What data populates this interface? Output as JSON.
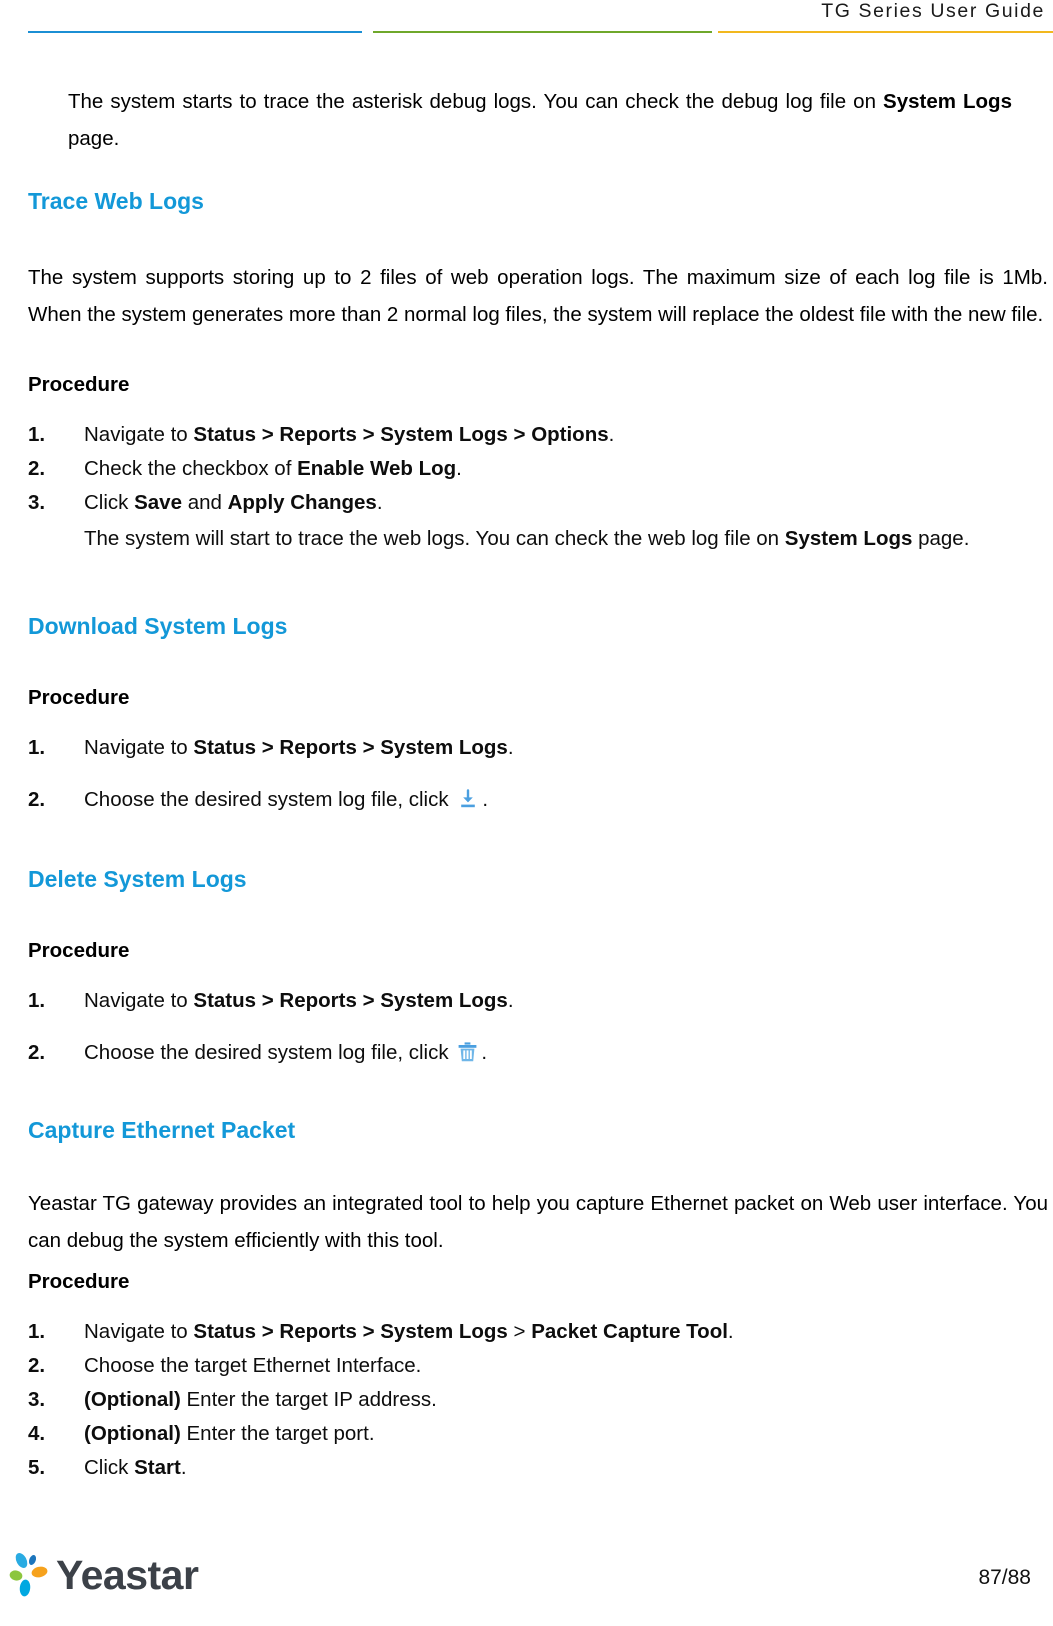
{
  "header": {
    "title": "TG Series User Guide",
    "rule_colors": {
      "blue": "#1B8FD4",
      "green": "#6FA82B",
      "yellow": "#F2B81E"
    }
  },
  "theme": {
    "heading_color": "#1398D8",
    "icon_color": "#4A9FE0",
    "body_color": "#0d0d0d"
  },
  "intro": {
    "text_before": "The system starts to trace the asterisk debug logs. You can check the debug log file on ",
    "bold": "System Logs",
    "text_after": " page."
  },
  "sections": [
    {
      "heading": "Trace Web Logs",
      "intro": "The system supports storing up to 2 files of web operation logs. The maximum size of each log file is 1Mb. When the system generates more than 2 normal log files, the system will replace the oldest file with the new file.",
      "procedure_label": "Procedure",
      "steps": [
        {
          "num": "1.",
          "parts": [
            {
              "text": "Navigate to ",
              "bold": false
            },
            {
              "text": "Status > Reports > System Logs > Options",
              "bold": true
            },
            {
              "text": ".",
              "bold": false
            }
          ]
        },
        {
          "num": "2.",
          "parts": [
            {
              "text": "Check the checkbox of ",
              "bold": false
            },
            {
              "text": "Enable Web Log",
              "bold": true
            },
            {
              "text": ".",
              "bold": false
            }
          ]
        },
        {
          "num": "3.",
          "parts": [
            {
              "text": "Click ",
              "bold": false
            },
            {
              "text": "Save",
              "bold": true
            },
            {
              "text": " and ",
              "bold": false
            },
            {
              "text": "Apply Changes",
              "bold": true
            },
            {
              "text": ".",
              "bold": false
            }
          ],
          "sub_parts": [
            {
              "text": "The system will start to trace the web logs. You can check the web log file on ",
              "bold": false
            },
            {
              "text": "System Logs",
              "bold": true
            },
            {
              "text": " page.",
              "bold": false
            }
          ]
        }
      ]
    },
    {
      "heading": "Download System Logs",
      "procedure_label": "Procedure",
      "steps": [
        {
          "num": "1.",
          "parts": [
            {
              "text": "Navigate to ",
              "bold": false
            },
            {
              "text": "Status > Reports > System Logs",
              "bold": true
            },
            {
              "text": ".",
              "bold": false
            }
          ]
        },
        {
          "num": "2.",
          "parts": [
            {
              "text": "Choose the desired system log file, click ",
              "bold": false
            }
          ],
          "icon": "download-icon",
          "parts_after": [
            {
              "text": ".",
              "bold": false
            }
          ]
        }
      ]
    },
    {
      "heading": "Delete System Logs",
      "procedure_label": "Procedure",
      "steps": [
        {
          "num": "1.",
          "parts": [
            {
              "text": "Navigate to ",
              "bold": false
            },
            {
              "text": "Status > Reports > System Logs",
              "bold": true
            },
            {
              "text": ".",
              "bold": false
            }
          ]
        },
        {
          "num": "2.",
          "parts": [
            {
              "text": "Choose the desired system log file, click ",
              "bold": false
            }
          ],
          "icon": "trash-icon",
          "parts_after": [
            {
              "text": ".",
              "bold": false
            }
          ]
        }
      ]
    },
    {
      "heading": "Capture Ethernet Packet",
      "intro": "Yeastar TG gateway provides an integrated tool to help you capture Ethernet packet on Web user interface. You can debug the system efficiently with this tool.",
      "procedure_label": "Procedure",
      "steps": [
        {
          "num": "1.",
          "parts": [
            {
              "text": "Navigate to ",
              "bold": false
            },
            {
              "text": "Status > Reports > System Logs",
              "bold": true
            },
            {
              "text": " > ",
              "bold": false
            },
            {
              "text": "Packet Capture Tool",
              "bold": true
            },
            {
              "text": ".",
              "bold": false
            }
          ]
        },
        {
          "num": "2.",
          "parts": [
            {
              "text": "Choose the target Ethernet Interface.",
              "bold": false
            }
          ]
        },
        {
          "num": "3.",
          "parts": [
            {
              "text": "(Optional)",
              "bold": true
            },
            {
              "text": " Enter the target IP address.",
              "bold": false
            }
          ]
        },
        {
          "num": "4.",
          "parts": [
            {
              "text": "(Optional)",
              "bold": true
            },
            {
              "text": " Enter the target port.",
              "bold": false
            }
          ]
        },
        {
          "num": "5.",
          "parts": [
            {
              "text": "Click ",
              "bold": false
            },
            {
              "text": "Start",
              "bold": true
            },
            {
              "text": ".",
              "bold": false
            }
          ]
        }
      ]
    }
  ],
  "footer": {
    "logo_text": "Yeastar",
    "page_number": "87/88",
    "logo_colors": {
      "light_blue": "#29ABE2",
      "dark_blue": "#1C75BC",
      "orange": "#F6A21D",
      "green": "#8CC63E",
      "cyan": "#00A8E1",
      "wordmark": "#3C4148"
    }
  }
}
